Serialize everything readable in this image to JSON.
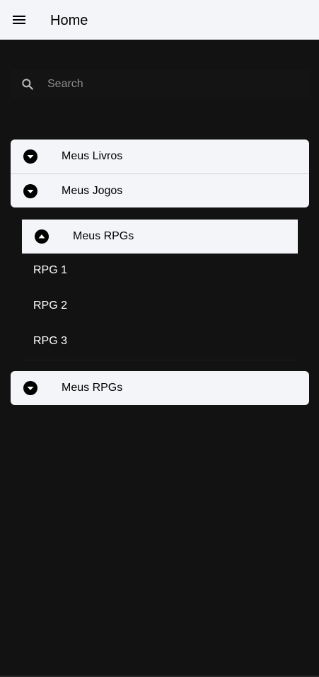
{
  "header": {
    "title": "Home",
    "menu_icon": "menu-icon"
  },
  "search": {
    "placeholder": "Search",
    "icon": "search-icon"
  },
  "accordion_top": {
    "items": [
      {
        "label": "Meus Livros",
        "icon": "chevron-down-circle-icon"
      },
      {
        "label": "Meus Jogos",
        "icon": "chevron-down-circle-icon"
      }
    ]
  },
  "accordion_expanded": {
    "label": "Meus RPGs",
    "icon": "chevron-up-circle-icon",
    "children": [
      "RPG 1",
      "RPG 2",
      "RPG 3"
    ]
  },
  "accordion_bottom": {
    "label": "Meus RPGs",
    "icon": "chevron-down-circle-icon"
  },
  "colors": {
    "background": "#121212",
    "surface": "#f4f5f8",
    "text_dark": "#000000",
    "text_light": "#ffffff",
    "placeholder": "#8c8c8c"
  }
}
